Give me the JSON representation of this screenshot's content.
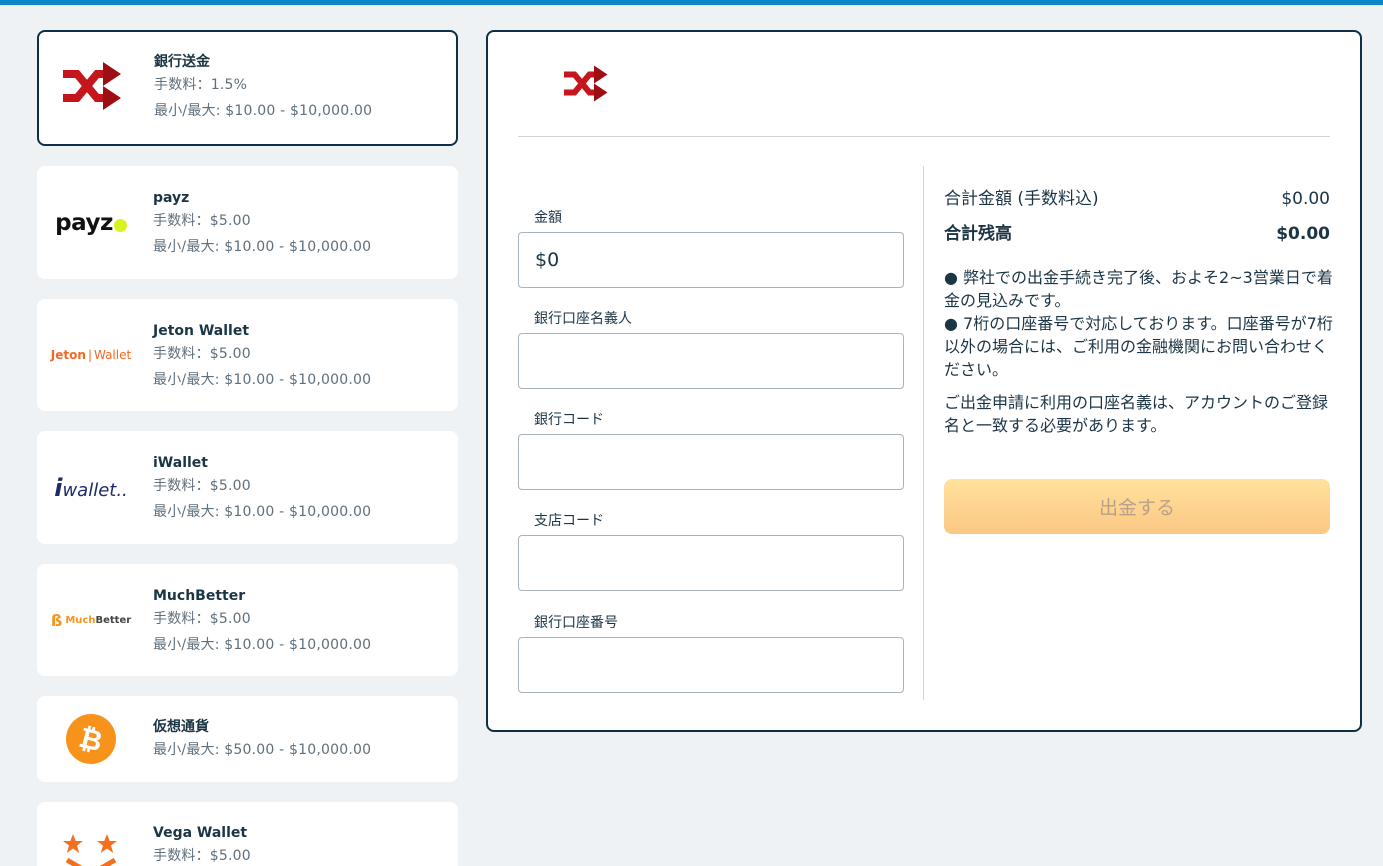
{
  "colors": {
    "accent_top": "#0b86c9",
    "selected_border": "#0e2f44",
    "button_gradient": [
      "#ffe29c",
      "#fbc784"
    ],
    "bank_icon": "#c4161c"
  },
  "methods": [
    {
      "name": "銀行送金",
      "fee": "手数料：1.5%",
      "limits": "最小/最大: $10.00 - $10,000.00",
      "icon": "bank-transfer-shuffle-icon",
      "selected": true
    },
    {
      "name": "payz",
      "fee": "手数料：$5.00",
      "limits": "最小/最大: $10.00 - $10,000.00",
      "icon": "payz-logo",
      "logo_text": "payz"
    },
    {
      "name": "Jeton Wallet",
      "fee": "手数料：$5.00",
      "limits": "最小/最大: $10.00 - $10,000.00",
      "icon": "jeton-logo",
      "logo_text": [
        "Jeton",
        "Wallet"
      ]
    },
    {
      "name": "iWallet",
      "fee": "手数料：$5.00",
      "limits": "最小/最大: $10.00 - $10,000.00",
      "icon": "iwallet-logo",
      "logo_text": "wallet.."
    },
    {
      "name": "MuchBetter",
      "fee": "手数料：$5.00",
      "limits": "最小/最大: $10.00 - $10,000.00",
      "icon": "muchbetter-logo",
      "logo_text": [
        "Much",
        "Better"
      ]
    },
    {
      "name": "仮想通貨",
      "limits": "最小/最大: $50.00 - $10,000.00",
      "icon": "bitcoin-icon"
    },
    {
      "name": "Vega Wallet",
      "fee": "手数料：$5.00",
      "icon": "vega-wallet-logo"
    }
  ],
  "form": {
    "amount_label": "金額",
    "amount_value": "$0",
    "holder_label": "銀行口座名義人",
    "holder_value": "",
    "bank_code_label": "銀行コード",
    "bank_code_value": "",
    "branch_code_label": "支店コード",
    "branch_code_value": "",
    "account_number_label": "銀行口座番号",
    "account_number_value": ""
  },
  "summary": {
    "total_label": "合計金額 (手数料込)",
    "total_value": "$0.00",
    "balance_label": "合計残高",
    "balance_value": "$0.00",
    "note1": "● 弊社での出金手続き完了後、およそ2~3営業日で着金の見込みです。",
    "note2": "● 7桁の口座番号で対応しております。口座番号が7桁以外の場合には、ご利用の金融機関にお問い合わせください。",
    "note3": "ご出金申請に利用の口座名義は、アカウントのご登録名と一致する必要があります。",
    "withdraw_button": "出金する"
  }
}
